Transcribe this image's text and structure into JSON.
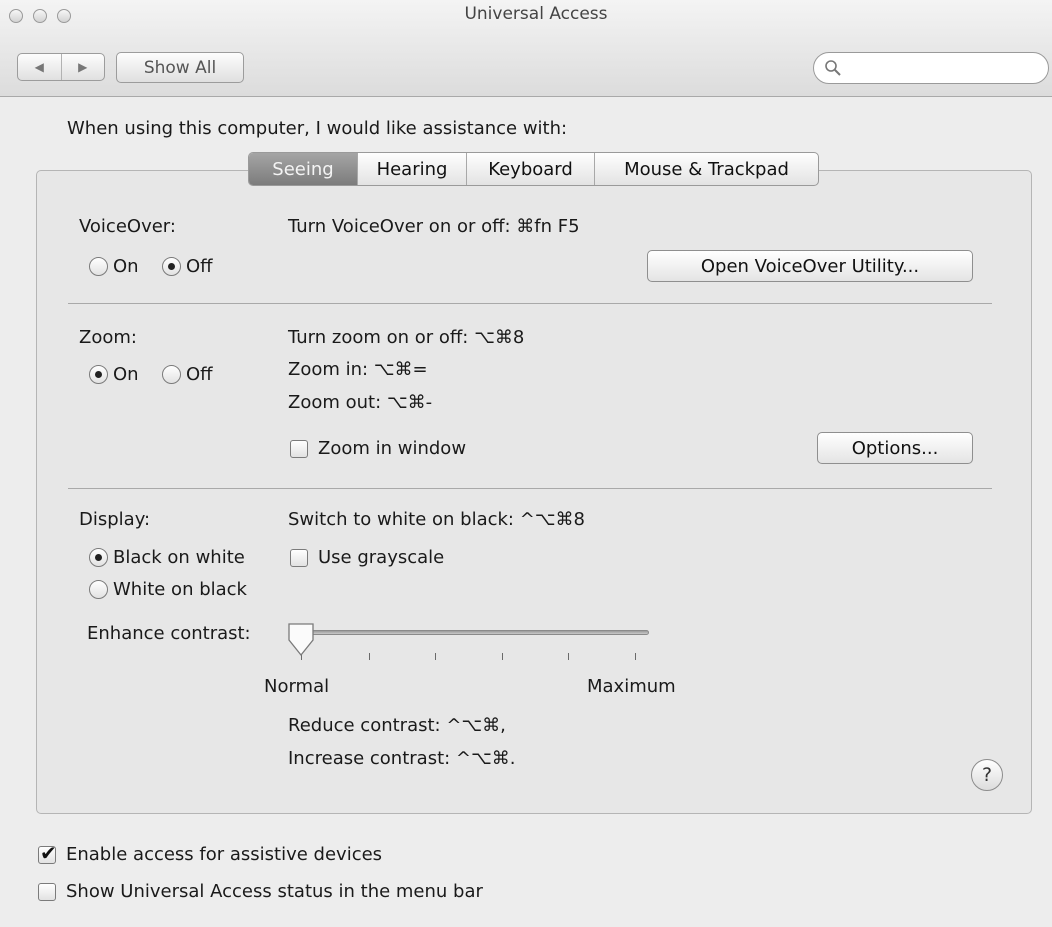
{
  "window": {
    "title": "Universal Access",
    "nav": {
      "back_glyph": "◀",
      "forward_glyph": "▶"
    },
    "show_all_label": "Show All",
    "search": {
      "value": "",
      "placeholder": ""
    }
  },
  "prompt": "When using this computer, I would like assistance with:",
  "tabs": [
    {
      "label": "Seeing",
      "active": true
    },
    {
      "label": "Hearing",
      "active": false
    },
    {
      "label": "Keyboard",
      "active": false
    },
    {
      "label": "Mouse & Trackpad",
      "active": false
    }
  ],
  "voiceover": {
    "label": "VoiceOver:",
    "shortcut": "Turn VoiceOver on or off: ⌘fn F5",
    "on_label": "On",
    "off_label": "Off",
    "selected": "Off",
    "utility_button": "Open VoiceOver Utility..."
  },
  "zoom": {
    "label": "Zoom:",
    "toggle_shortcut": "Turn zoom on or off: ⌥⌘8",
    "zoom_in": "Zoom in: ⌥⌘=",
    "zoom_out": "Zoom out: ⌥⌘-",
    "on_label": "On",
    "off_label": "Off",
    "selected": "On",
    "zoom_in_window_label": "Zoom in window",
    "zoom_in_window_checked": false,
    "options_button": "Options..."
  },
  "display": {
    "label": "Display:",
    "switch_shortcut": "Switch to white on black: ^⌥⌘8",
    "black_on_white": "Black on white",
    "white_on_black": "White on black",
    "selected": "Black on white",
    "grayscale_label": "Use grayscale",
    "grayscale_checked": false,
    "enhance_contrast_label": "Enhance contrast:",
    "contrast_level": 0,
    "min_label": "Normal",
    "max_label": "Maximum",
    "reduce_contrast": "Reduce contrast: ^⌥⌘,",
    "increase_contrast": "Increase contrast: ^⌥⌘."
  },
  "help_glyph": "?",
  "footer": {
    "assistive_label": "Enable access for assistive devices",
    "assistive_checked": true,
    "status_label": "Show Universal Access status in the menu bar",
    "status_checked": false
  }
}
